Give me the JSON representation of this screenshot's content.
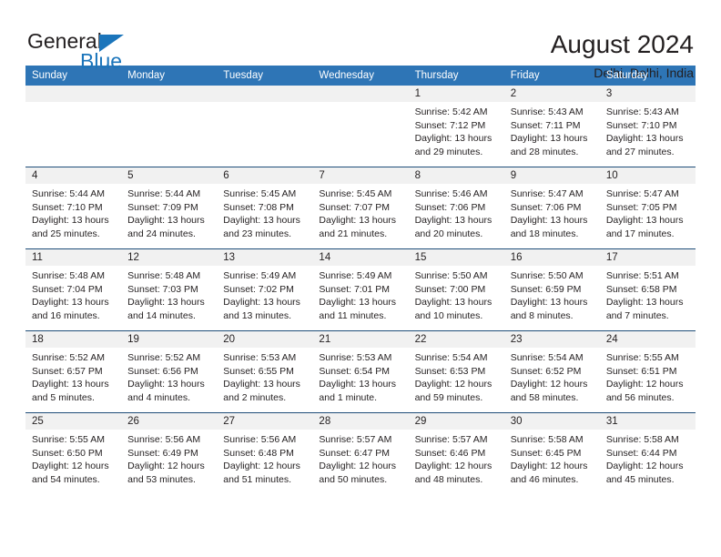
{
  "brand": {
    "name_top": "General",
    "name_bottom": "Blue",
    "accent_color": "#1b75bb"
  },
  "header": {
    "month_title": "August 2024",
    "location": "Delhi, Delhi, India"
  },
  "calendar": {
    "header_bg": "#2e75b6",
    "daynum_bg": "#f1f1f1",
    "row_border": "#1f4e79",
    "weekdays": [
      "Sunday",
      "Monday",
      "Tuesday",
      "Wednesday",
      "Thursday",
      "Friday",
      "Saturday"
    ],
    "weeks": [
      [
        {
          "day": "",
          "empty": true,
          "sunrise": "",
          "sunset": "",
          "daylight": ""
        },
        {
          "day": "",
          "empty": true,
          "sunrise": "",
          "sunset": "",
          "daylight": ""
        },
        {
          "day": "",
          "empty": true,
          "sunrise": "",
          "sunset": "",
          "daylight": ""
        },
        {
          "day": "",
          "empty": true,
          "sunrise": "",
          "sunset": "",
          "daylight": ""
        },
        {
          "day": "1",
          "sunrise": "Sunrise: 5:42 AM",
          "sunset": "Sunset: 7:12 PM",
          "daylight": "Daylight: 13 hours and 29 minutes."
        },
        {
          "day": "2",
          "sunrise": "Sunrise: 5:43 AM",
          "sunset": "Sunset: 7:11 PM",
          "daylight": "Daylight: 13 hours and 28 minutes."
        },
        {
          "day": "3",
          "sunrise": "Sunrise: 5:43 AM",
          "sunset": "Sunset: 7:10 PM",
          "daylight": "Daylight: 13 hours and 27 minutes."
        }
      ],
      [
        {
          "day": "4",
          "sunrise": "Sunrise: 5:44 AM",
          "sunset": "Sunset: 7:10 PM",
          "daylight": "Daylight: 13 hours and 25 minutes."
        },
        {
          "day": "5",
          "sunrise": "Sunrise: 5:44 AM",
          "sunset": "Sunset: 7:09 PM",
          "daylight": "Daylight: 13 hours and 24 minutes."
        },
        {
          "day": "6",
          "sunrise": "Sunrise: 5:45 AM",
          "sunset": "Sunset: 7:08 PM",
          "daylight": "Daylight: 13 hours and 23 minutes."
        },
        {
          "day": "7",
          "sunrise": "Sunrise: 5:45 AM",
          "sunset": "Sunset: 7:07 PM",
          "daylight": "Daylight: 13 hours and 21 minutes."
        },
        {
          "day": "8",
          "sunrise": "Sunrise: 5:46 AM",
          "sunset": "Sunset: 7:06 PM",
          "daylight": "Daylight: 13 hours and 20 minutes."
        },
        {
          "day": "9",
          "sunrise": "Sunrise: 5:47 AM",
          "sunset": "Sunset: 7:06 PM",
          "daylight": "Daylight: 13 hours and 18 minutes."
        },
        {
          "day": "10",
          "sunrise": "Sunrise: 5:47 AM",
          "sunset": "Sunset: 7:05 PM",
          "daylight": "Daylight: 13 hours and 17 minutes."
        }
      ],
      [
        {
          "day": "11",
          "sunrise": "Sunrise: 5:48 AM",
          "sunset": "Sunset: 7:04 PM",
          "daylight": "Daylight: 13 hours and 16 minutes."
        },
        {
          "day": "12",
          "sunrise": "Sunrise: 5:48 AM",
          "sunset": "Sunset: 7:03 PM",
          "daylight": "Daylight: 13 hours and 14 minutes."
        },
        {
          "day": "13",
          "sunrise": "Sunrise: 5:49 AM",
          "sunset": "Sunset: 7:02 PM",
          "daylight": "Daylight: 13 hours and 13 minutes."
        },
        {
          "day": "14",
          "sunrise": "Sunrise: 5:49 AM",
          "sunset": "Sunset: 7:01 PM",
          "daylight": "Daylight: 13 hours and 11 minutes."
        },
        {
          "day": "15",
          "sunrise": "Sunrise: 5:50 AM",
          "sunset": "Sunset: 7:00 PM",
          "daylight": "Daylight: 13 hours and 10 minutes."
        },
        {
          "day": "16",
          "sunrise": "Sunrise: 5:50 AM",
          "sunset": "Sunset: 6:59 PM",
          "daylight": "Daylight: 13 hours and 8 minutes."
        },
        {
          "day": "17",
          "sunrise": "Sunrise: 5:51 AM",
          "sunset": "Sunset: 6:58 PM",
          "daylight": "Daylight: 13 hours and 7 minutes."
        }
      ],
      [
        {
          "day": "18",
          "sunrise": "Sunrise: 5:52 AM",
          "sunset": "Sunset: 6:57 PM",
          "daylight": "Daylight: 13 hours and 5 minutes."
        },
        {
          "day": "19",
          "sunrise": "Sunrise: 5:52 AM",
          "sunset": "Sunset: 6:56 PM",
          "daylight": "Daylight: 13 hours and 4 minutes."
        },
        {
          "day": "20",
          "sunrise": "Sunrise: 5:53 AM",
          "sunset": "Sunset: 6:55 PM",
          "daylight": "Daylight: 13 hours and 2 minutes."
        },
        {
          "day": "21",
          "sunrise": "Sunrise: 5:53 AM",
          "sunset": "Sunset: 6:54 PM",
          "daylight": "Daylight: 13 hours and 1 minute."
        },
        {
          "day": "22",
          "sunrise": "Sunrise: 5:54 AM",
          "sunset": "Sunset: 6:53 PM",
          "daylight": "Daylight: 12 hours and 59 minutes."
        },
        {
          "day": "23",
          "sunrise": "Sunrise: 5:54 AM",
          "sunset": "Sunset: 6:52 PM",
          "daylight": "Daylight: 12 hours and 58 minutes."
        },
        {
          "day": "24",
          "sunrise": "Sunrise: 5:55 AM",
          "sunset": "Sunset: 6:51 PM",
          "daylight": "Daylight: 12 hours and 56 minutes."
        }
      ],
      [
        {
          "day": "25",
          "sunrise": "Sunrise: 5:55 AM",
          "sunset": "Sunset: 6:50 PM",
          "daylight": "Daylight: 12 hours and 54 minutes."
        },
        {
          "day": "26",
          "sunrise": "Sunrise: 5:56 AM",
          "sunset": "Sunset: 6:49 PM",
          "daylight": "Daylight: 12 hours and 53 minutes."
        },
        {
          "day": "27",
          "sunrise": "Sunrise: 5:56 AM",
          "sunset": "Sunset: 6:48 PM",
          "daylight": "Daylight: 12 hours and 51 minutes."
        },
        {
          "day": "28",
          "sunrise": "Sunrise: 5:57 AM",
          "sunset": "Sunset: 6:47 PM",
          "daylight": "Daylight: 12 hours and 50 minutes."
        },
        {
          "day": "29",
          "sunrise": "Sunrise: 5:57 AM",
          "sunset": "Sunset: 6:46 PM",
          "daylight": "Daylight: 12 hours and 48 minutes."
        },
        {
          "day": "30",
          "sunrise": "Sunrise: 5:58 AM",
          "sunset": "Sunset: 6:45 PM",
          "daylight": "Daylight: 12 hours and 46 minutes."
        },
        {
          "day": "31",
          "sunrise": "Sunrise: 5:58 AM",
          "sunset": "Sunset: 6:44 PM",
          "daylight": "Daylight: 12 hours and 45 minutes."
        }
      ]
    ]
  }
}
